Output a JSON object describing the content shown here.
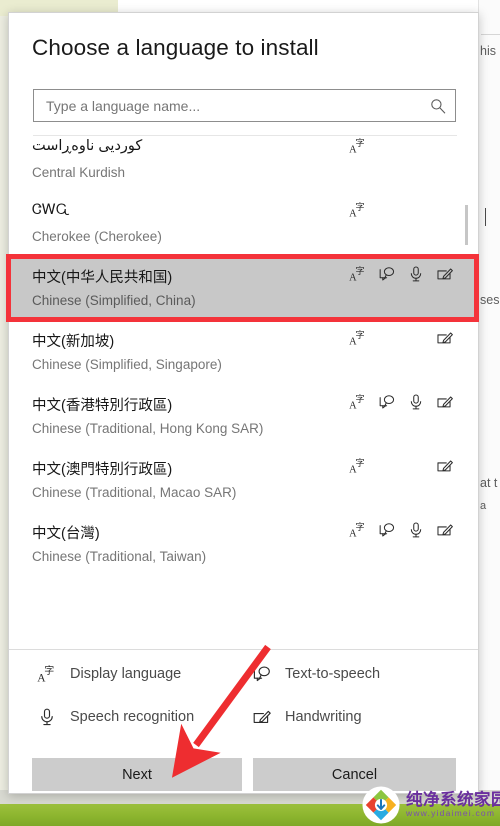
{
  "dialog": {
    "title": "Choose a language to install",
    "search": {
      "placeholder": "Type a language name...",
      "value": "",
      "icon": "search-icon"
    },
    "languages": [
      {
        "native": "کوردیی ناوەڕاست",
        "english": "Central Kurdish",
        "selected": false,
        "clipped_top": true,
        "features": [
          "display-language"
        ]
      },
      {
        "native": "ᏣᎳᏩ",
        "english": "Cherokee (Cherokee)",
        "selected": false,
        "clipped_top": false,
        "features": [
          "display-language"
        ]
      },
      {
        "native": "中文(中华人民共和国)",
        "english": "Chinese (Simplified, China)",
        "selected": true,
        "clipped_top": false,
        "features": [
          "display-language",
          "text-to-speech",
          "speech-recognition",
          "handwriting"
        ]
      },
      {
        "native": "中文(新加坡)",
        "english": "Chinese (Simplified, Singapore)",
        "selected": false,
        "clipped_top": false,
        "features": [
          "display-language",
          "handwriting"
        ]
      },
      {
        "native": "中文(香港特別行政區)",
        "english": "Chinese (Traditional, Hong Kong SAR)",
        "selected": false,
        "clipped_top": false,
        "features": [
          "display-language",
          "text-to-speech",
          "speech-recognition",
          "handwriting"
        ]
      },
      {
        "native": "中文(澳門特別行政區)",
        "english": "Chinese (Traditional, Macao SAR)",
        "selected": false,
        "clipped_top": false,
        "features": [
          "display-language",
          "handwriting"
        ]
      },
      {
        "native": "中文(台灣)",
        "english": "Chinese (Traditional, Taiwan)",
        "selected": false,
        "clipped_top": false,
        "features": [
          "display-language",
          "text-to-speech",
          "speech-recognition",
          "handwriting"
        ]
      }
    ],
    "legend": [
      {
        "icon": "display-language",
        "label": "Display language"
      },
      {
        "icon": "text-to-speech",
        "label": "Text-to-speech"
      },
      {
        "icon": "speech-recognition",
        "label": "Speech recognition"
      },
      {
        "icon": "handwriting",
        "label": "Handwriting"
      }
    ],
    "footer": {
      "next_label": "Next",
      "cancel_label": "Cancel"
    }
  },
  "background": {
    "fragments": [
      "his",
      "ses",
      "at t",
      "a"
    ]
  },
  "annotations": {
    "highlight_color": "#f4333a",
    "arrow_color": "#ee2d30",
    "highlight_target": "Chinese (Simplified, China)",
    "arrow_target": "Next"
  },
  "watermark": {
    "name": "纯净系统家园",
    "url": "www.yidaimei.com"
  },
  "colors": {
    "selected_row": "#c8c8c8",
    "button_face": "#cccccc",
    "accent_green": "#8cb52e",
    "dialog_bg": "#ffffff"
  }
}
